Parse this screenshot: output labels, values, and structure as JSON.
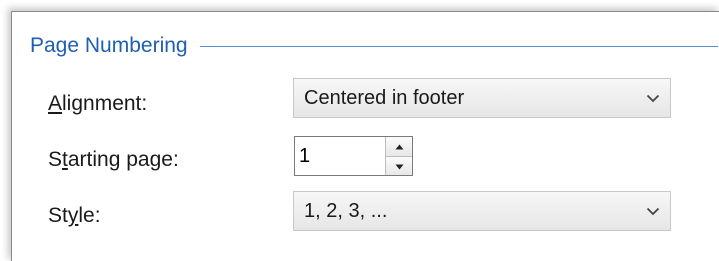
{
  "group": {
    "title": "Page Numbering"
  },
  "alignment": {
    "label_accel": "A",
    "label_rest": "lignment:",
    "value": "Centered in footer"
  },
  "starting_page": {
    "label_pre": "S",
    "label_accel": "t",
    "label_rest": "arting page:",
    "value": "1"
  },
  "style": {
    "label_pre": "St",
    "label_accel": "y",
    "label_rest": "le:",
    "value": "1, 2, 3, ..."
  },
  "icons": {
    "dropdown": "chevron-down-icon",
    "spin_up": "arrow-up-icon",
    "spin_down": "arrow-down-icon"
  },
  "colors": {
    "group_title": "#1e5fb4",
    "group_rule": "#5a8fd6"
  }
}
